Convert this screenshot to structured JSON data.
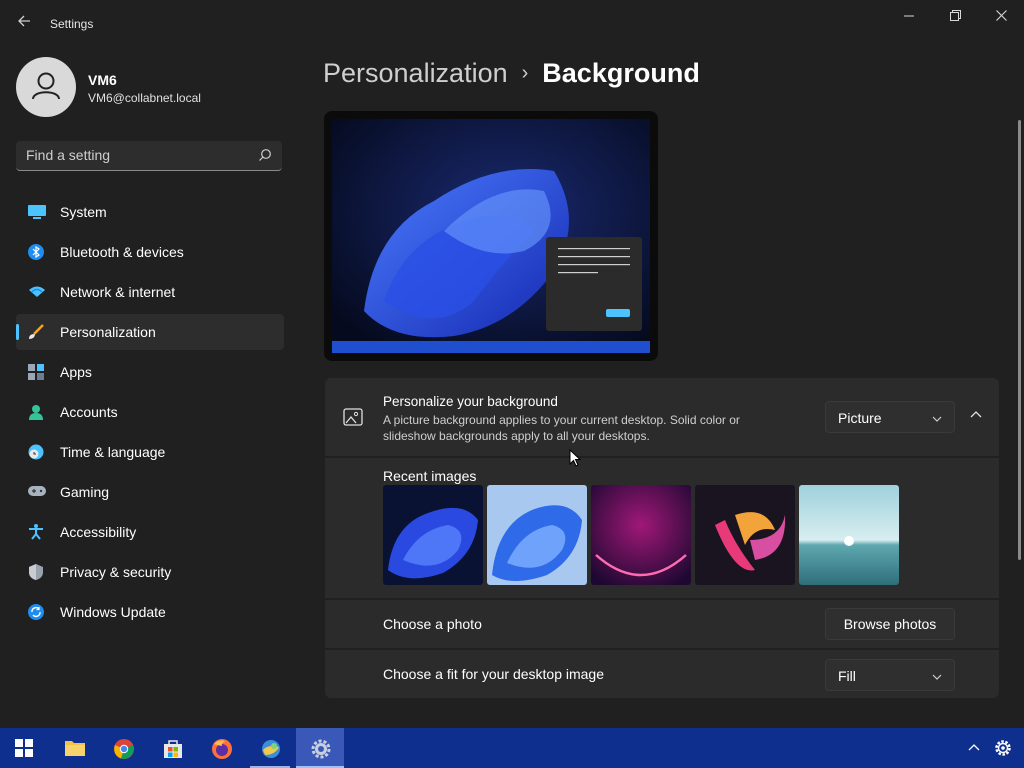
{
  "window": {
    "title": "Settings",
    "controls": [
      "minimize",
      "maximize",
      "close"
    ]
  },
  "user": {
    "name": "VM6",
    "email": "VM6@collabnet.local"
  },
  "search": {
    "placeholder": "Find a setting"
  },
  "nav": {
    "items": [
      {
        "label": "System",
        "icon": "monitor-icon"
      },
      {
        "label": "Bluetooth & devices",
        "icon": "bluetooth-icon"
      },
      {
        "label": "Network & internet",
        "icon": "wifi-icon"
      },
      {
        "label": "Personalization",
        "icon": "brush-icon",
        "active": true
      },
      {
        "label": "Apps",
        "icon": "apps-icon"
      },
      {
        "label": "Accounts",
        "icon": "person-icon"
      },
      {
        "label": "Time & language",
        "icon": "clock-globe-icon"
      },
      {
        "label": "Gaming",
        "icon": "gamepad-icon"
      },
      {
        "label": "Accessibility",
        "icon": "accessibility-icon"
      },
      {
        "label": "Privacy & security",
        "icon": "shield-icon"
      },
      {
        "label": "Windows Update",
        "icon": "update-icon"
      }
    ]
  },
  "breadcrumb": {
    "parent": "Personalization",
    "separator": "›",
    "current": "Background"
  },
  "background": {
    "title": "Personalize your background",
    "description": "A picture background applies to your current desktop. Solid color or slideshow backgrounds apply to all your desktops.",
    "type_value": "Picture",
    "recent_label": "Recent images",
    "recent_images": [
      "bloom-dark-blue",
      "bloom-light-blue",
      "purple-glow",
      "colorful-ribbon",
      "lake-sunrise"
    ],
    "choose_photo_label": "Choose a photo",
    "browse_label": "Browse photos",
    "fit_label": "Choose a fit for your desktop image",
    "fit_value": "Fill"
  },
  "taskbar": {
    "items": [
      "start-button",
      "file-explorer",
      "chrome",
      "microsoft-store",
      "firefox",
      "control-panel",
      "settings"
    ],
    "tray": [
      "show-hidden-icons",
      "settings-gear"
    ]
  },
  "colors": {
    "accent": "#4cc2ff",
    "taskbar": "#0f2f8f",
    "window_bg": "#202020",
    "card_bg": "#2b2b2b"
  }
}
